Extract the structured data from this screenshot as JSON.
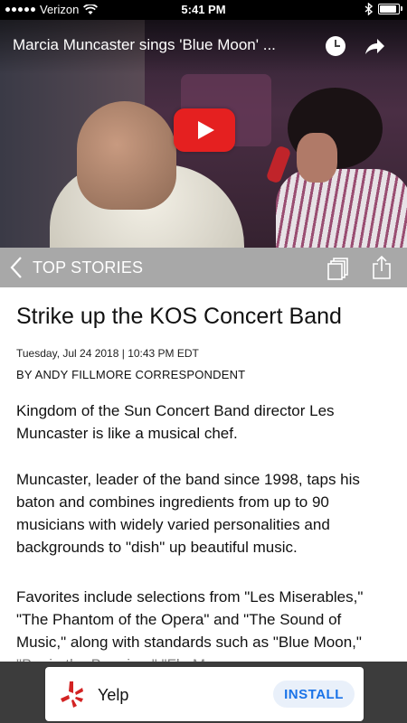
{
  "status_bar": {
    "carrier": "Verizon",
    "time": "5:41 PM"
  },
  "video": {
    "title": "Marcia Muncaster sings 'Blue Moon' ..."
  },
  "nav": {
    "back_label": "TOP STORIES"
  },
  "article": {
    "headline": "Strike up the KOS Concert Band",
    "dateline": "Tuesday, Jul 24 2018 | 10:43 PM EDT",
    "byline": "BY ANDY FILLMORE CORRESPONDENT",
    "paragraphs": [
      "Kingdom of the Sun Concert Band director Les Muncaster is like a musical chef.",
      "Muncaster, leader of the band since 1998, taps his baton and combines ingredients from up to 90 musicians with widely varied personalities and backgrounds to \"dish\" up beautiful music.",
      "Favorites include selections from \"Les Miserables,\" \"The Phantom of the Opera\" and \"The Sound of Music,\" along with standards such as \"Blue Moon,\" \"Begin the Beguine,\" \"Flo Mo"
    ]
  },
  "ad": {
    "app_name": "Yelp",
    "install_label": "INSTALL",
    "brand_color": "#d32323",
    "button_text_color": "#1a73e8"
  },
  "colors": {
    "nav_bar": "#a8a8a8",
    "play_button": "#e52020"
  }
}
